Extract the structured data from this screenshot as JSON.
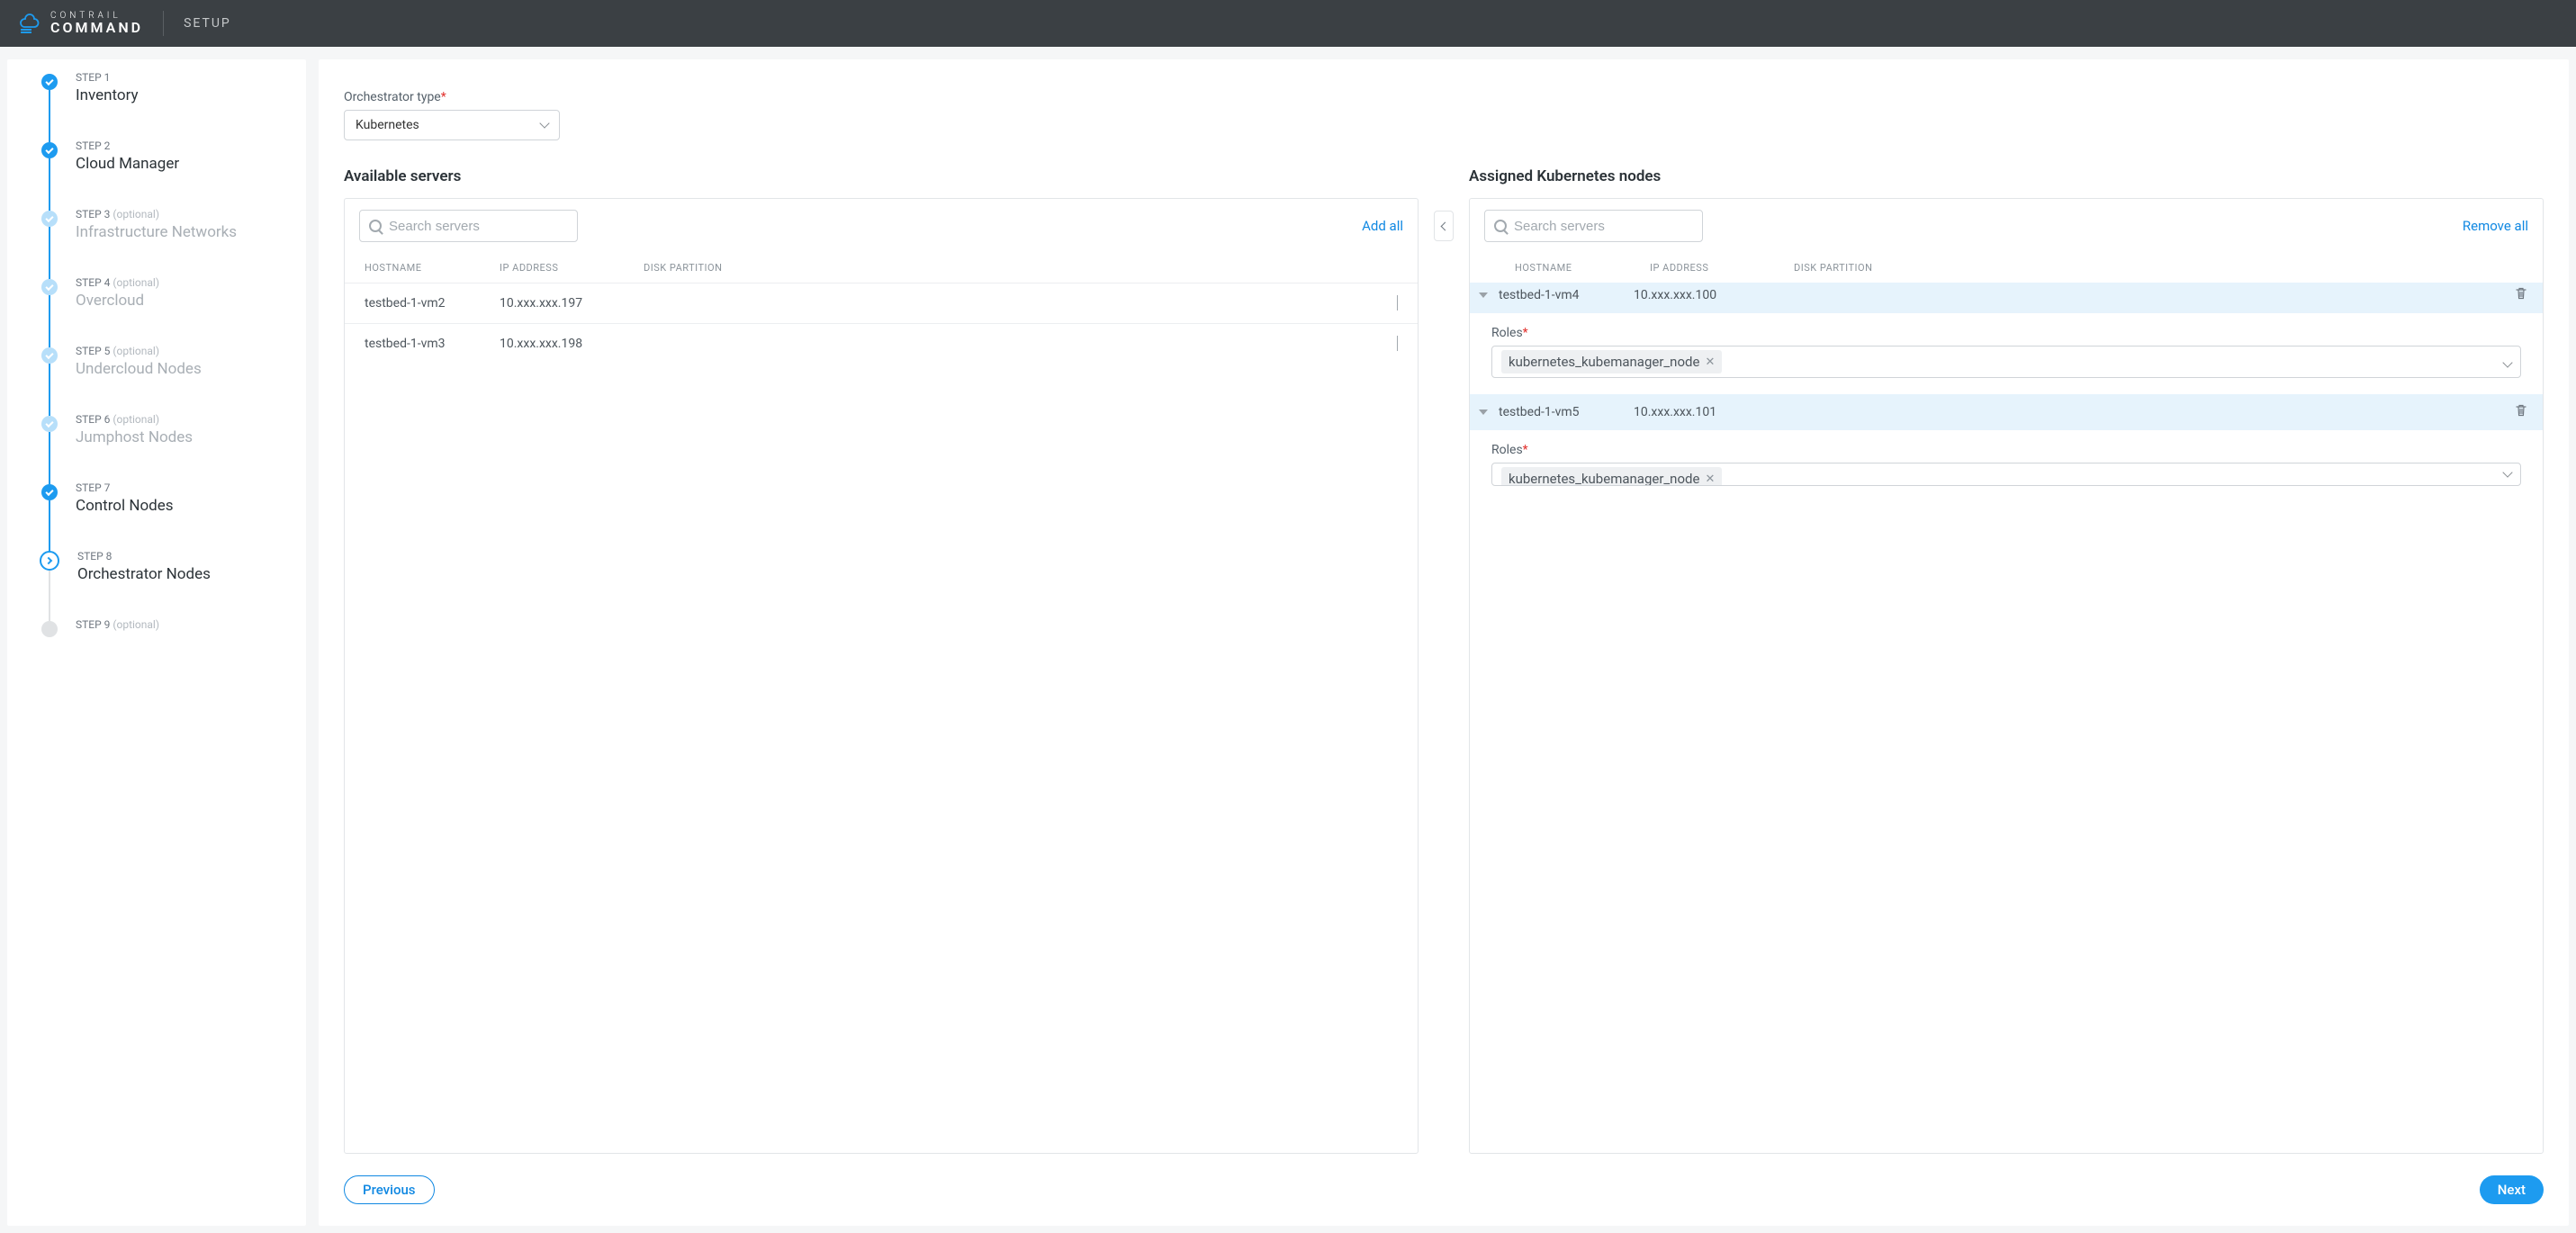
{
  "header": {
    "brand_line1": "CONTRAIL",
    "brand_line2": "COMMAND",
    "title": "SETUP"
  },
  "steps": [
    {
      "num": "STEP 1",
      "title": "Inventory",
      "state": "done"
    },
    {
      "num": "STEP 2",
      "title": "Cloud Manager",
      "state": "done"
    },
    {
      "num": "STEP 3",
      "optional": "(optional)",
      "title": "Infrastructure Networks",
      "state": "done-light"
    },
    {
      "num": "STEP 4",
      "optional": "(optional)",
      "title": "Overcloud",
      "state": "done-light"
    },
    {
      "num": "STEP 5",
      "optional": "(optional)",
      "title": "Undercloud Nodes",
      "state": "done-light"
    },
    {
      "num": "STEP 6",
      "optional": "(optional)",
      "title": "Jumphost Nodes",
      "state": "done-light"
    },
    {
      "num": "STEP 7",
      "title": "Control Nodes",
      "state": "done"
    },
    {
      "num": "STEP 8",
      "title": "Orchestrator Nodes",
      "state": "current"
    },
    {
      "num": "STEP 9",
      "optional": "(optional)",
      "title": "",
      "state": "future"
    }
  ],
  "form": {
    "orchestrator_label": "Orchestrator type",
    "orchestrator_value": "Kubernetes"
  },
  "available": {
    "title": "Available servers",
    "search_placeholder": "Search servers",
    "add_all": "Add all",
    "columns": {
      "host": "HOSTNAME",
      "ip": "IP ADDRESS",
      "part": "DISK PARTITION"
    },
    "rows": [
      {
        "host": "testbed-1-vm2",
        "ip": "10.xxx.xxx.197"
      },
      {
        "host": "testbed-1-vm3",
        "ip": "10.xxx.xxx.198"
      }
    ]
  },
  "assigned": {
    "title": "Assigned Kubernetes nodes",
    "search_placeholder": "Search servers",
    "remove_all": "Remove all",
    "columns": {
      "host": "HOSTNAME",
      "ip": "IP ADDRESS",
      "part": "DISK PARTITION"
    },
    "roles_label": "Roles",
    "nodes": [
      {
        "host": "testbed-1-vm4",
        "ip": "10.xxx.xxx.100",
        "role": "kubernetes_kubemanager_node"
      },
      {
        "host": "testbed-1-vm5",
        "ip": "10.xxx.xxx.101",
        "role": "kubernetes_kubemanager_node"
      }
    ]
  },
  "footer": {
    "previous": "Previous",
    "next": "Next"
  }
}
